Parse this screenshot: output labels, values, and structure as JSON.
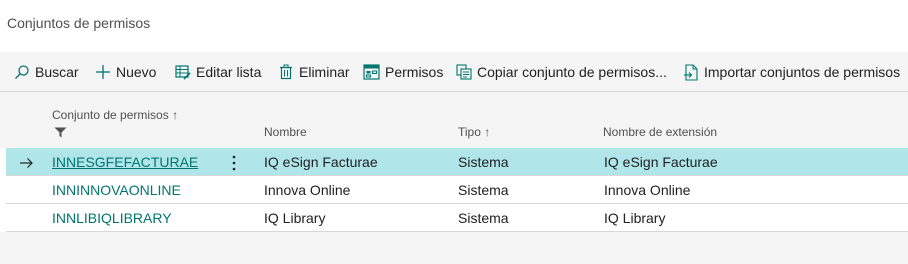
{
  "page": {
    "title": "Conjuntos de permisos"
  },
  "toolbar": {
    "search": {
      "label": "Buscar",
      "icon": "search-icon"
    },
    "new": {
      "label": "Nuevo",
      "icon": "plus-icon"
    },
    "edit_list": {
      "label": "Editar lista",
      "icon": "edit-list-icon"
    },
    "delete": {
      "label": "Eliminar",
      "icon": "trash-icon"
    },
    "permissions": {
      "label": "Permisos",
      "icon": "permissions-icon"
    },
    "copy": {
      "label": "Copiar conjunto de permisos...",
      "icon": "copy-icon"
    },
    "import": {
      "label": "Importar conjuntos de permisos",
      "icon": "import-icon"
    }
  },
  "table": {
    "columns": {
      "set": "Conjunto de permisos ↑",
      "name": "Nombre",
      "type": "Tipo ↑",
      "extension": "Nombre de extensión"
    },
    "rows": [
      {
        "set": "INNESGFEFACTURAE",
        "name": "IQ eSign Facturae",
        "type": "Sistema",
        "extension": "IQ eSign Facturae",
        "selected": true
      },
      {
        "set": "INNINNOVAONLINE",
        "name": "Innova Online",
        "type": "Sistema",
        "extension": "Innova Online",
        "selected": false
      },
      {
        "set": "INNLIBIQLIBRARY",
        "name": "IQ Library",
        "type": "Sistema",
        "extension": "IQ Library",
        "selected": false
      }
    ]
  },
  "colors": {
    "accent": "#00766f",
    "selected_row": "#b0e6ea",
    "toolbar_bg": "#f5f5f5"
  }
}
